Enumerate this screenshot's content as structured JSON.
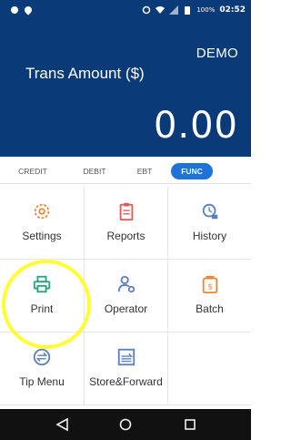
{
  "status_bar": {
    "battery": "100%",
    "time": "02:52"
  },
  "header": {
    "mode_label": "DEMO",
    "trans_label": "Trans Amount ($)",
    "amount": "0.00"
  },
  "tabs": [
    {
      "label": "CREDIT",
      "active": false
    },
    {
      "label": "DEBIT",
      "active": false
    },
    {
      "label": "EBT",
      "active": false
    },
    {
      "label": "FUNC",
      "active": true
    }
  ],
  "menu": [
    {
      "label": "Settings",
      "icon": "gear-icon",
      "color": "#e8893a"
    },
    {
      "label": "Reports",
      "icon": "clipboard-icon",
      "color": "#e05a5a"
    },
    {
      "label": "History",
      "icon": "history-icon",
      "color": "#5b7fbf"
    },
    {
      "label": "Print",
      "icon": "printer-icon",
      "color": "#2aa37a"
    },
    {
      "label": "Operator",
      "icon": "operator-icon",
      "color": "#5b7fbf"
    },
    {
      "label": "Batch",
      "icon": "batch-icon",
      "color": "#e8893a"
    },
    {
      "label": "Tip Menu",
      "icon": "tip-menu-icon",
      "color": "#5b7fbf"
    },
    {
      "label": "Store&Forward",
      "icon": "store-forward-icon",
      "color": "#5b7fbf"
    }
  ],
  "colors": {
    "header_bg": "#0a3b78",
    "tab_active": "#1e73d9",
    "highlight": "#ffff33"
  }
}
